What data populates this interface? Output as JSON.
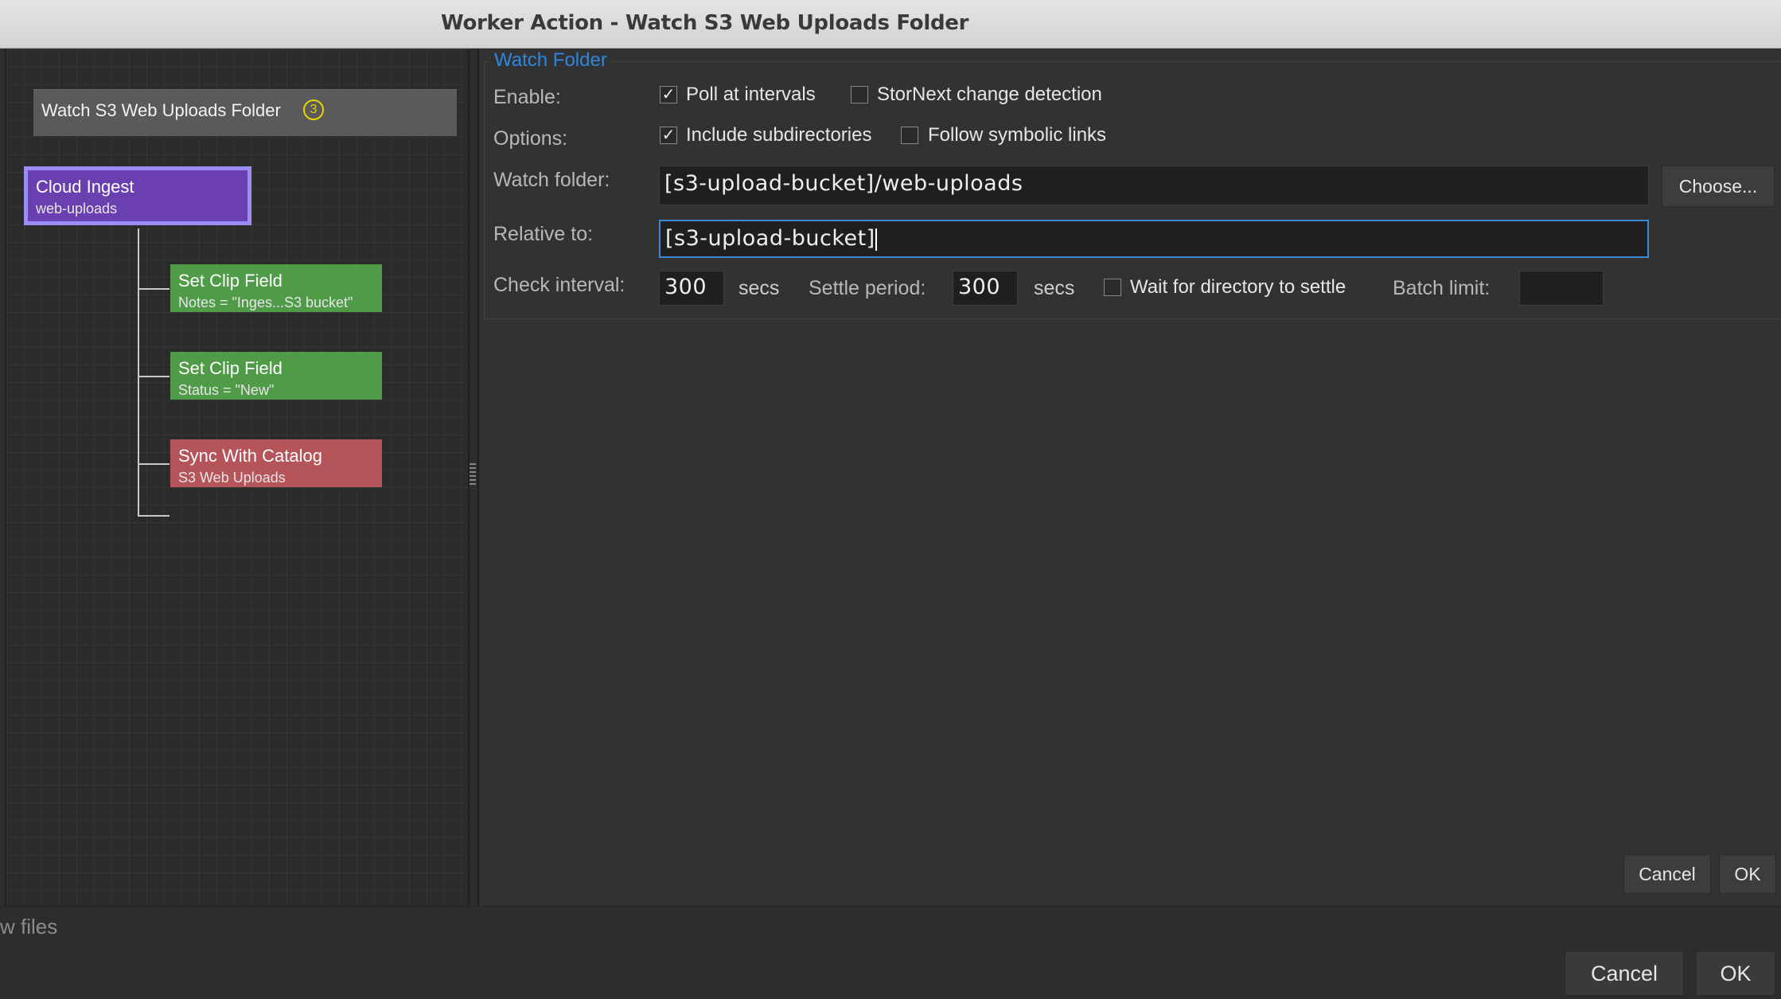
{
  "window": {
    "title": "Worker Action - Watch S3 Web Uploads Folder"
  },
  "workflow": {
    "trigger": {
      "label": "Watch S3 Web Uploads Folder",
      "badge": "3"
    },
    "nodes": [
      {
        "title": "Cloud Ingest",
        "subtitle": "web-uploads"
      },
      {
        "title": "Set Clip Field",
        "subtitle": "Notes = \"Inges...S3 bucket\""
      },
      {
        "title": "Set Clip Field",
        "subtitle": "Status = \"New\""
      },
      {
        "title": "Sync With Catalog",
        "subtitle": "S3 Web Uploads"
      }
    ]
  },
  "watch_folder": {
    "legend": "Watch Folder",
    "enable_label": "Enable:",
    "poll_label": "Poll at intervals",
    "poll_checked": true,
    "stornext_label": "StorNext change detection",
    "stornext_checked": false,
    "options_label": "Options:",
    "include_sub_label": "Include subdirectories",
    "include_sub_checked": true,
    "follow_links_label": "Follow symbolic links",
    "follow_links_checked": false,
    "watch_folder_label": "Watch folder:",
    "watch_folder_value": "[s3-upload-bucket]/web-uploads",
    "choose_label": "Choose...",
    "relative_label": "Relative to:",
    "relative_value": "[s3-upload-bucket]",
    "check_interval_label": "Check interval:",
    "check_interval_value": "300",
    "secs1": "secs",
    "settle_label": "Settle period:",
    "settle_value": "300",
    "secs2": "secs",
    "wait_label": "Wait for directory to settle",
    "wait_checked": false,
    "batch_label": "Batch limit:",
    "batch_value": ""
  },
  "inner_buttons": {
    "cancel": "Cancel",
    "ok": "OK"
  },
  "footer": {
    "status_text": "w files",
    "cancel": "Cancel",
    "ok": "OK"
  },
  "colors": {
    "legend": "#2e86de",
    "cloud_ingest": "#6a3fb0",
    "set_clip": "#4f9b48",
    "sync": "#b5555a",
    "focus": "#3b8ad8"
  }
}
